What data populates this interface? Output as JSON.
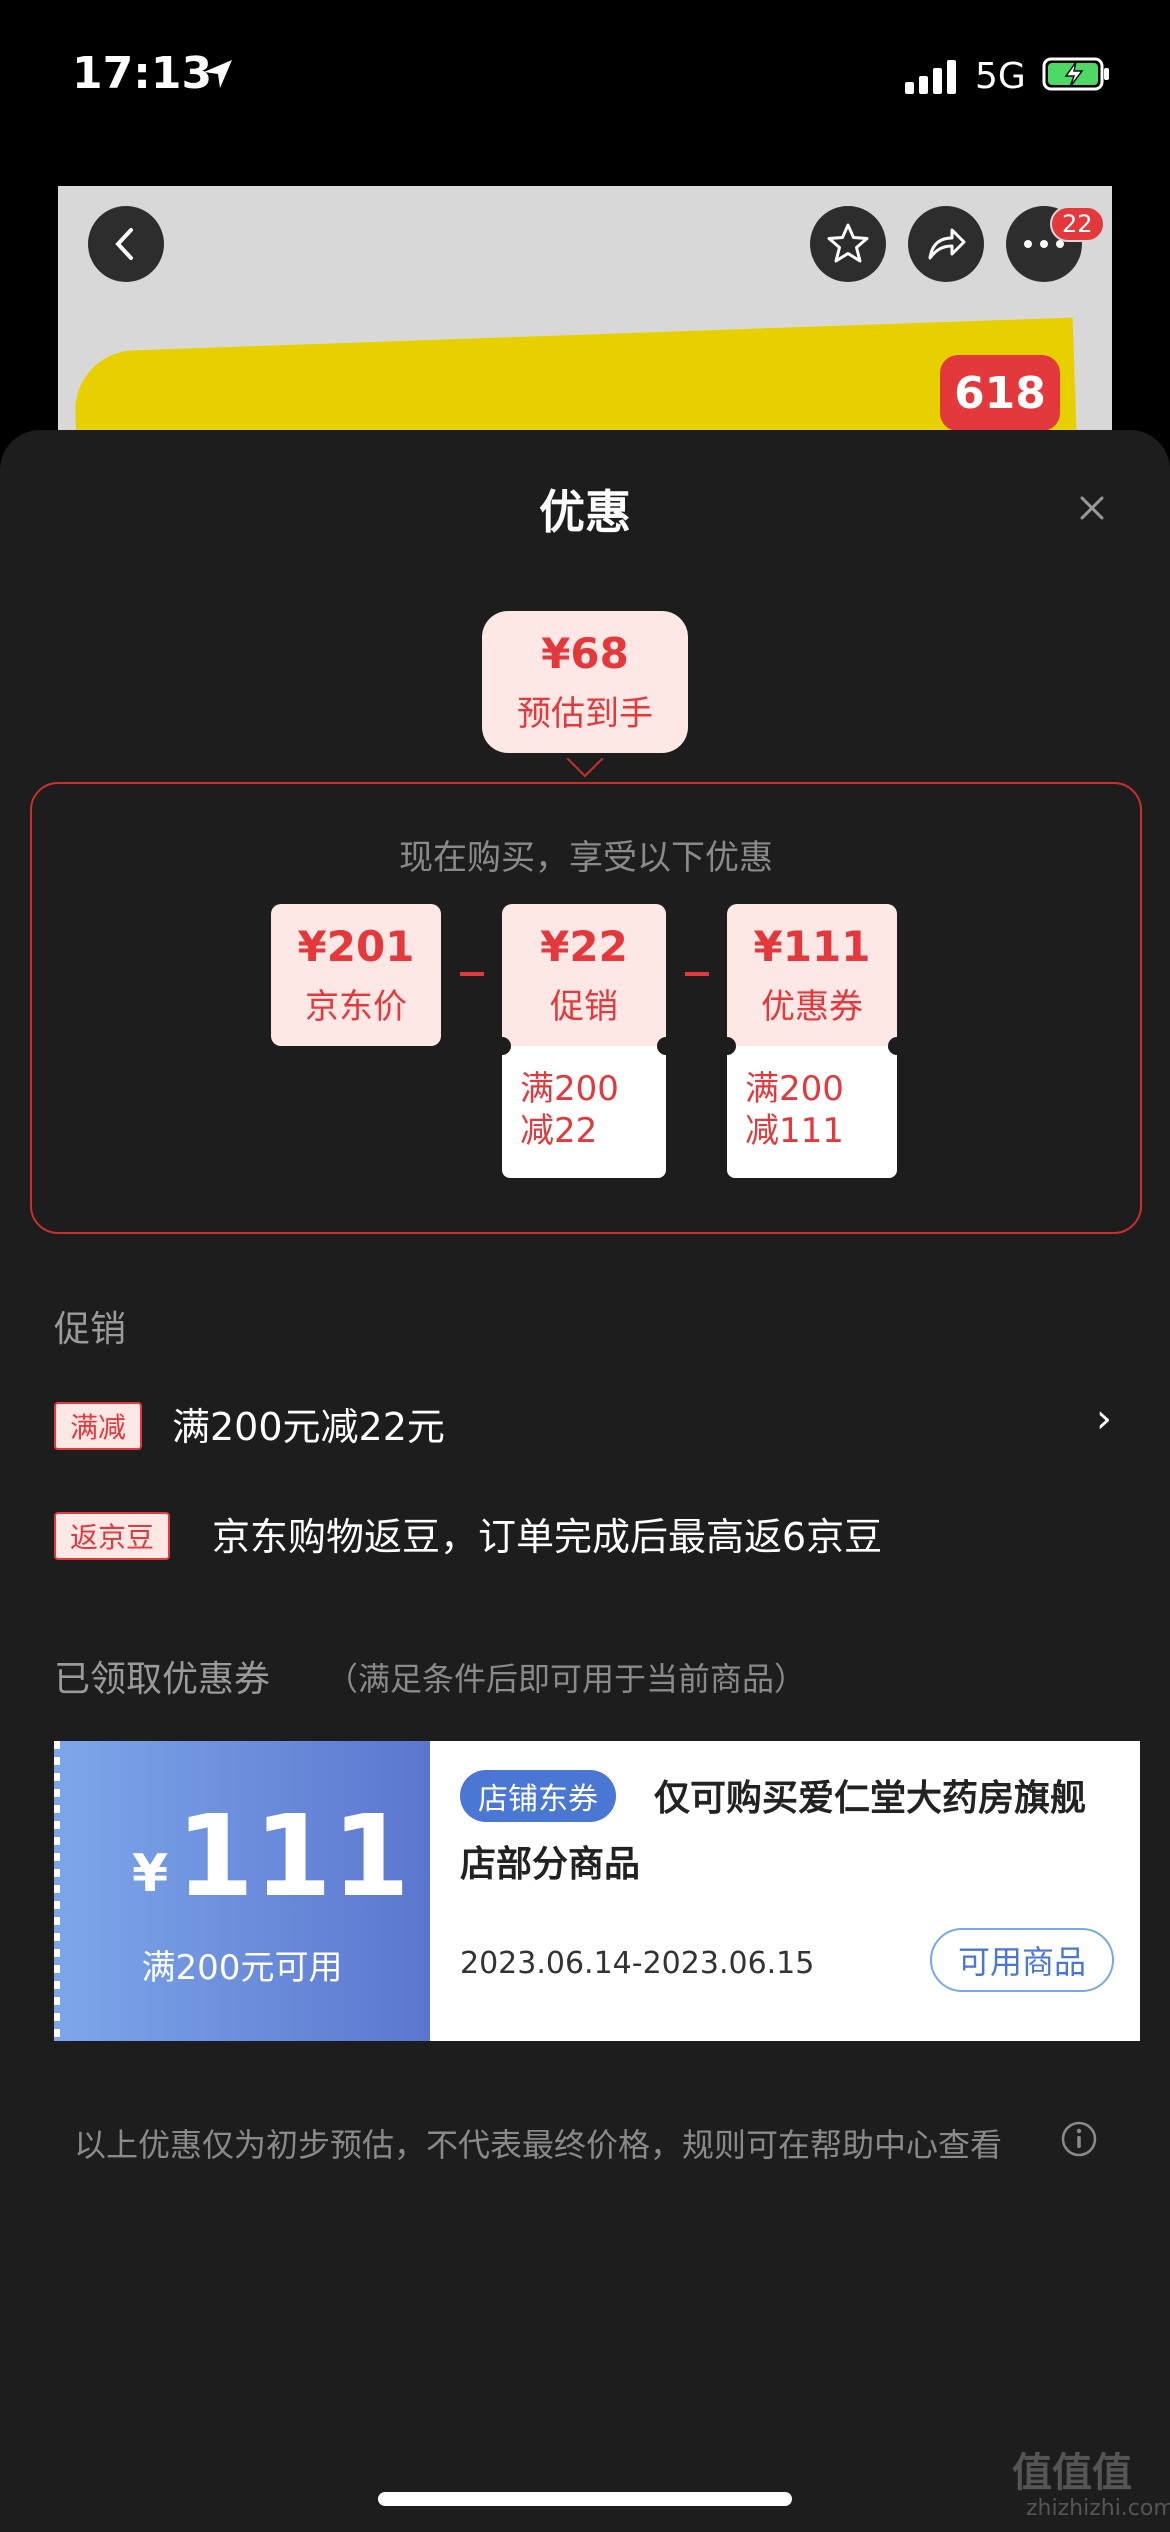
{
  "status": {
    "time": "17:13",
    "network": "5G"
  },
  "background": {
    "menu_badge": "22",
    "promo_badge": "618"
  },
  "sheet": {
    "title": "优惠",
    "estimate": {
      "price": "¥68",
      "label": "预估到手"
    },
    "calc_heading": "现在购买，享受以下优惠",
    "cards": [
      {
        "price": "¥201",
        "label": "京东价"
      },
      {
        "price": "¥22",
        "label": "促销",
        "detail_1": "满200",
        "detail_2": "减22"
      },
      {
        "price": "¥111",
        "label": "优惠券",
        "detail_1": "满200",
        "detail_2": "减111"
      }
    ],
    "promo_section_label": "促销",
    "promos": [
      {
        "tag": "满减",
        "text": "满200元减22元"
      },
      {
        "tag": "返京豆",
        "text": "京东购物返豆，订单完成后最高返6京豆"
      }
    ],
    "coupon_section_label": "已领取优惠券",
    "coupon_section_note": "（满足条件后即可用于当前商品）",
    "coupon": {
      "currency": "¥",
      "amount": "111",
      "condition": "满200元可用",
      "store_tag": "店铺东券",
      "description": "仅可购买爱仁堂大药房旗舰店部分商品",
      "date_range": "2023.06.14-2023.06.15",
      "button": "可用商品"
    },
    "footer_note": "以上优惠仅为初步预估，不代表最终价格，规则可在帮助中心查看"
  },
  "watermark": {
    "main": "值值值",
    "sub": "zhizhizhi.com"
  },
  "colors": {
    "accent": "#e4393c",
    "coupon_blue": "#5b76cf"
  }
}
